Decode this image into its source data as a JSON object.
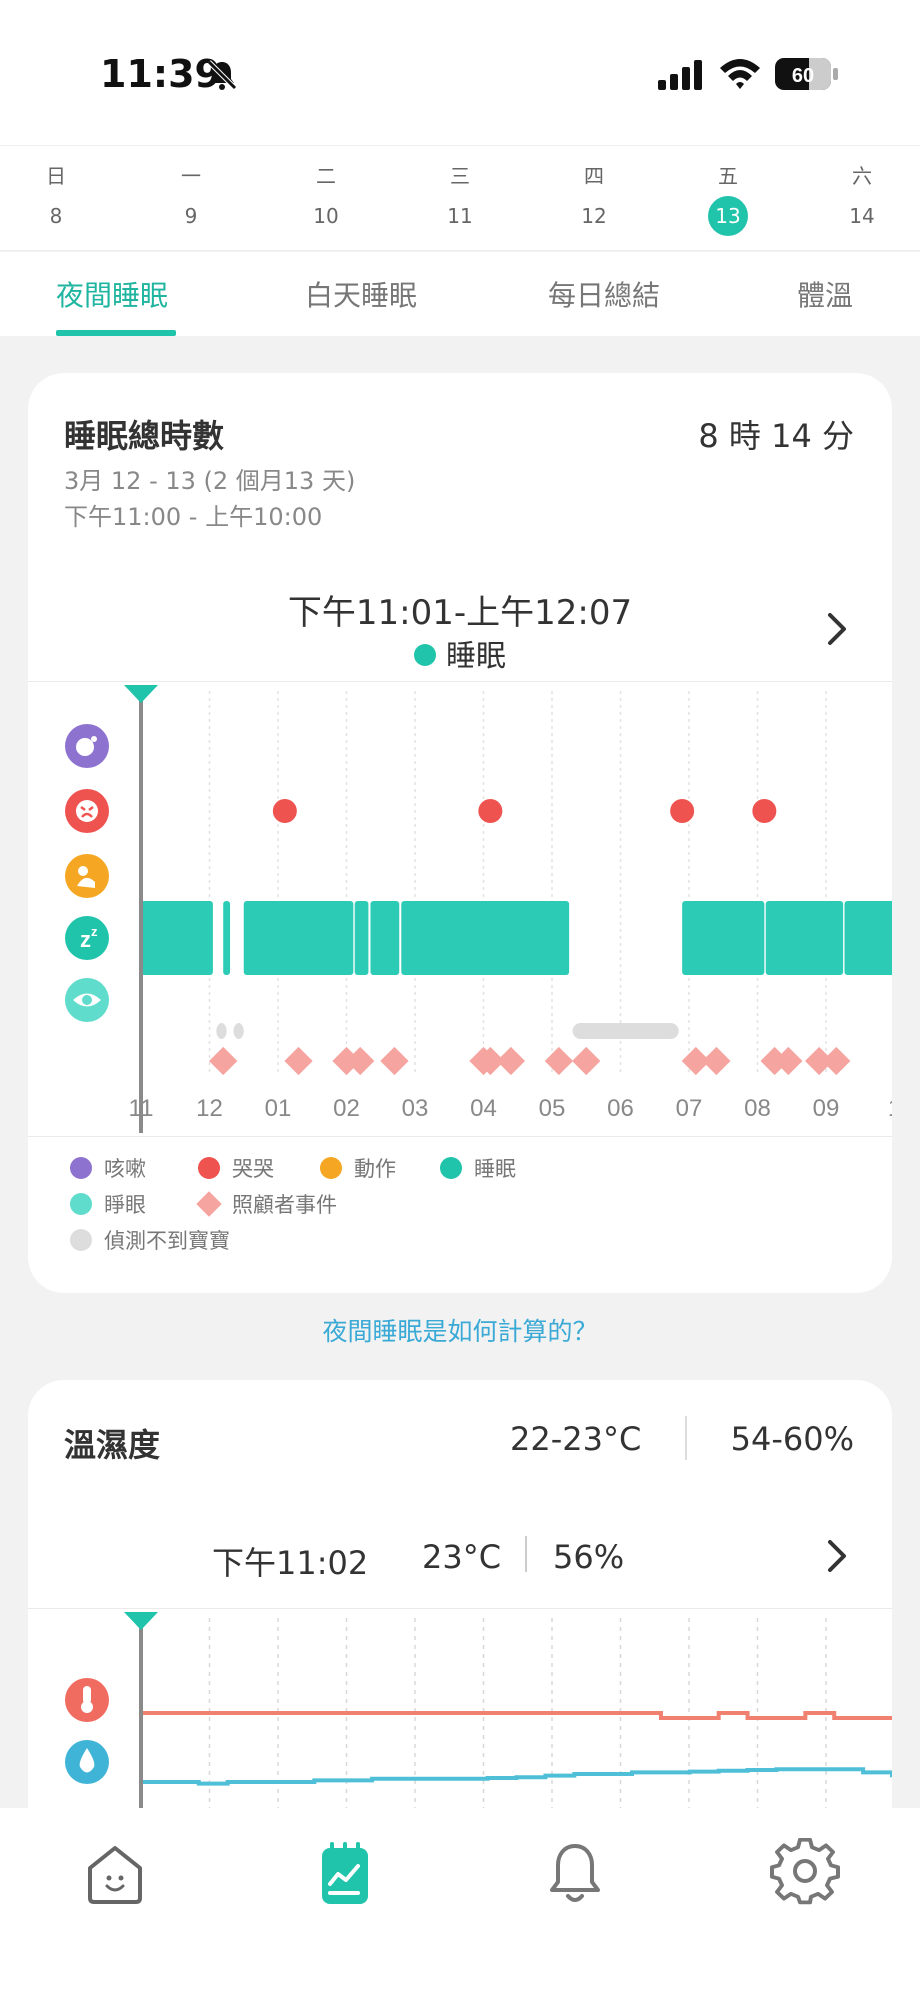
{
  "status_bar": {
    "time": "11:39",
    "battery": "60",
    "icons": [
      "silent-bell-icon",
      "cell-signal-icon",
      "wifi-icon",
      "battery-icon"
    ]
  },
  "week": [
    {
      "name": "日",
      "num": "8",
      "selected": false
    },
    {
      "name": "一",
      "num": "9",
      "selected": false
    },
    {
      "name": "二",
      "num": "10",
      "selected": false
    },
    {
      "name": "三",
      "num": "11",
      "selected": false
    },
    {
      "name": "四",
      "num": "12",
      "selected": false
    },
    {
      "name": "五",
      "num": "13",
      "selected": true
    },
    {
      "name": "六",
      "num": "14",
      "selected": false
    }
  ],
  "tabs": [
    {
      "label": "夜間睡眠",
      "active": true
    },
    {
      "label": "白天睡眠",
      "active": false
    },
    {
      "label": "每日總結",
      "active": false
    },
    {
      "label": "體溫",
      "active": false
    }
  ],
  "sleep_card": {
    "title": "睡眠總時數",
    "total": "8 時 14 分",
    "date_range": "3月 12 - 13 (2 個月13 天)",
    "time_range": "下午11:00 - 上午10:00",
    "selected_time": "下午11:01-上午12:07",
    "selected_state": "睡眠"
  },
  "chart_data": [
    {
      "type": "timeline",
      "x_ticks": [
        "11",
        "12",
        "01",
        "02",
        "03",
        "04",
        "05",
        "06",
        "07",
        "08",
        "09",
        "1"
      ],
      "x_domain_hours": [
        0,
        11
      ],
      "rows": [
        "cough",
        "cry",
        "motion",
        "sleep",
        "awake",
        "no_baby",
        "caregiver"
      ],
      "cry_events": [
        2.1,
        5.1,
        7.9,
        9.1
      ],
      "sleep_segments": [
        [
          0,
          1.05
        ],
        [
          1.2,
          1.3
        ],
        [
          1.5,
          3.1
        ],
        [
          3.12,
          3.32
        ],
        [
          3.35,
          3.77
        ],
        [
          3.8,
          6.25
        ],
        [
          7.9,
          9.1
        ],
        [
          9.12,
          10.25
        ],
        [
          10.27,
          11.25
        ]
      ],
      "no_baby_segments": [
        [
          1.1,
          1.25
        ],
        [
          1.35,
          1.5
        ],
        [
          6.3,
          7.85
        ],
        [
          11.0,
          11.7
        ]
      ],
      "caregiver_events": [
        1.2,
        2.3,
        3.0,
        3.2,
        3.7,
        5.0,
        5.1,
        5.4,
        6.1,
        6.5,
        8.1,
        8.4,
        9.25,
        9.45,
        9.9,
        10.15
      ],
      "cursor_hour": 0
    },
    {
      "type": "line",
      "series": [
        {
          "name": "temperature",
          "color": "#f08070",
          "values": [
            23,
            23,
            23,
            23,
            23,
            23,
            23,
            23,
            23,
            23,
            23,
            23,
            23,
            23,
            23,
            23,
            23,
            23,
            22.8,
            22.8,
            23,
            22.8,
            22.8,
            23,
            22.8,
            22.8,
            22.8
          ]
        },
        {
          "name": "humidity",
          "color": "#4fbfd8",
          "values": [
            56,
            56,
            55.8,
            56,
            56,
            56,
            56.2,
            56.2,
            56.4,
            56.4,
            56.4,
            56.4,
            56.5,
            56.6,
            56.8,
            57,
            57,
            57.2,
            57.2,
            57.3,
            57.4,
            57.5,
            57.6,
            57.6,
            57.6,
            57.2,
            56.6
          ]
        }
      ],
      "cursor_hour": 0
    }
  ],
  "legend": [
    {
      "label": "咳嗽",
      "color": "#8e72cf",
      "shape": "circle"
    },
    {
      "label": "哭哭",
      "color": "#ef5350",
      "shape": "circle"
    },
    {
      "label": "動作",
      "color": "#f5a623",
      "shape": "circle"
    },
    {
      "label": "睡眠",
      "color": "#1fc4aa",
      "shape": "circle"
    },
    {
      "label": "睜眼",
      "color": "#5fdccc",
      "shape": "circle"
    },
    {
      "label": "照顧者事件",
      "color": "#f5a4a0",
      "shape": "diamond"
    },
    {
      "label": "偵測不到寶寶",
      "color": "#dddddd",
      "shape": "circle"
    }
  ],
  "row_icons": [
    {
      "name": "cough-icon",
      "color": "#8e72cf"
    },
    {
      "name": "cry-icon",
      "color": "#ef5350"
    },
    {
      "name": "motion-icon",
      "color": "#f5a623"
    },
    {
      "name": "sleep-icon",
      "color": "#1fc4aa"
    },
    {
      "name": "eye-icon",
      "color": "#5fdccc"
    }
  ],
  "how_link": "夜間睡眠是如何計算的？",
  "env_card": {
    "title": "溫濕度",
    "temp_range": "22-23°C",
    "humidity_range": "54-60%",
    "selected_time": "下午11:02",
    "selected_temp": "23°C",
    "selected_humidity": "56%",
    "icons": [
      "thermometer-icon",
      "droplet-icon"
    ]
  },
  "bottom_nav": [
    "home-icon",
    "report-icon",
    "notification-bell-icon",
    "settings-gear-icon"
  ],
  "colors": {
    "accent": "#1fc4aa",
    "cry": "#ef5350",
    "caregiver": "#f5a4a0",
    "nobaby": "#dddddd",
    "temp_line": "#f08070",
    "hum_line": "#4fbfd8",
    "link": "#3aa9d6"
  }
}
